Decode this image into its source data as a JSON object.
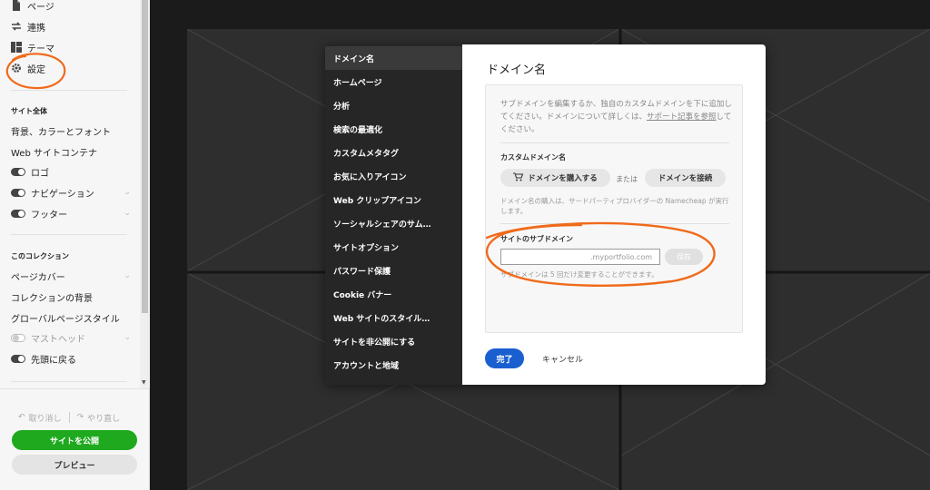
{
  "sidebar": {
    "top_nav": [
      {
        "label": "ページ",
        "icon": "page-icon"
      },
      {
        "label": "連携",
        "icon": "link-arrows-icon"
      },
      {
        "label": "テーマ",
        "icon": "theme-grid-icon"
      },
      {
        "label": "設定",
        "icon": "gear-icon"
      }
    ],
    "site_section_label": "サイト全体",
    "site_items": [
      {
        "label": "背景、カラーとフォント"
      },
      {
        "label": "Web サイトコンテナ"
      },
      {
        "label": "ロゴ",
        "toggle": "on"
      },
      {
        "label": "ナビゲーション",
        "toggle": "on",
        "chevron": true
      },
      {
        "label": "フッター",
        "toggle": "on",
        "chevron": true
      }
    ],
    "collection_section_label": "このコレクション",
    "collection_items": [
      {
        "label": "ページカバー",
        "chevron": true
      },
      {
        "label": "コレクションの背景"
      },
      {
        "label": "グローバルページスタイル"
      },
      {
        "label": "マストヘッド",
        "toggle": "off",
        "chevron": true,
        "dim": true
      },
      {
        "label": "先頭に戻る",
        "toggle": "on"
      }
    ],
    "undo_label": "取り消し",
    "redo_label": "やり直し",
    "publish_label": "サイトを公開",
    "preview_label": "プレビュー"
  },
  "modal": {
    "nav_items": [
      "ドメイン名",
      "ホームページ",
      "分析",
      "検索の最適化",
      "カスタムメタタグ",
      "お気に入りアイコン",
      "Web クリップアイコン",
      "ソーシャルシェアのサム…",
      "サイトオプション",
      "パスワード保護",
      "Cookie バナー",
      "Web サイトのスタイル…",
      "サイトを非公開にする",
      "アカウントと地域"
    ],
    "active_index": 0,
    "title": "ドメイン名",
    "intro_text": "サブドメインを編集するか、独自のカスタムドメインを下に追加してください。ドメインについて詳しくは、",
    "intro_link": "サポート記事を参照",
    "intro_end": "してください。",
    "custom_domain_heading": "カスタムドメイン名",
    "buy_domain_label": "ドメインを購入する",
    "or_text": "または",
    "connect_domain_label": "ドメインを接続",
    "purchase_note": "ドメイン名の購入は、サードパーティプロバイダーの Namecheap が実行します。",
    "subdomain_heading": "サイトのサブドメイン",
    "subdomain_value": "",
    "subdomain_suffix": ".myportfolio.com",
    "save_label": "保存",
    "subdomain_note": "サブドメインは 5 回だけ変更することができます。",
    "done_label": "完了",
    "cancel_label": "キャンセル"
  },
  "colors": {
    "publish_green": "#1ea91e",
    "done_blue": "#1a5fd0",
    "annotation_orange": "#f06a1a"
  }
}
